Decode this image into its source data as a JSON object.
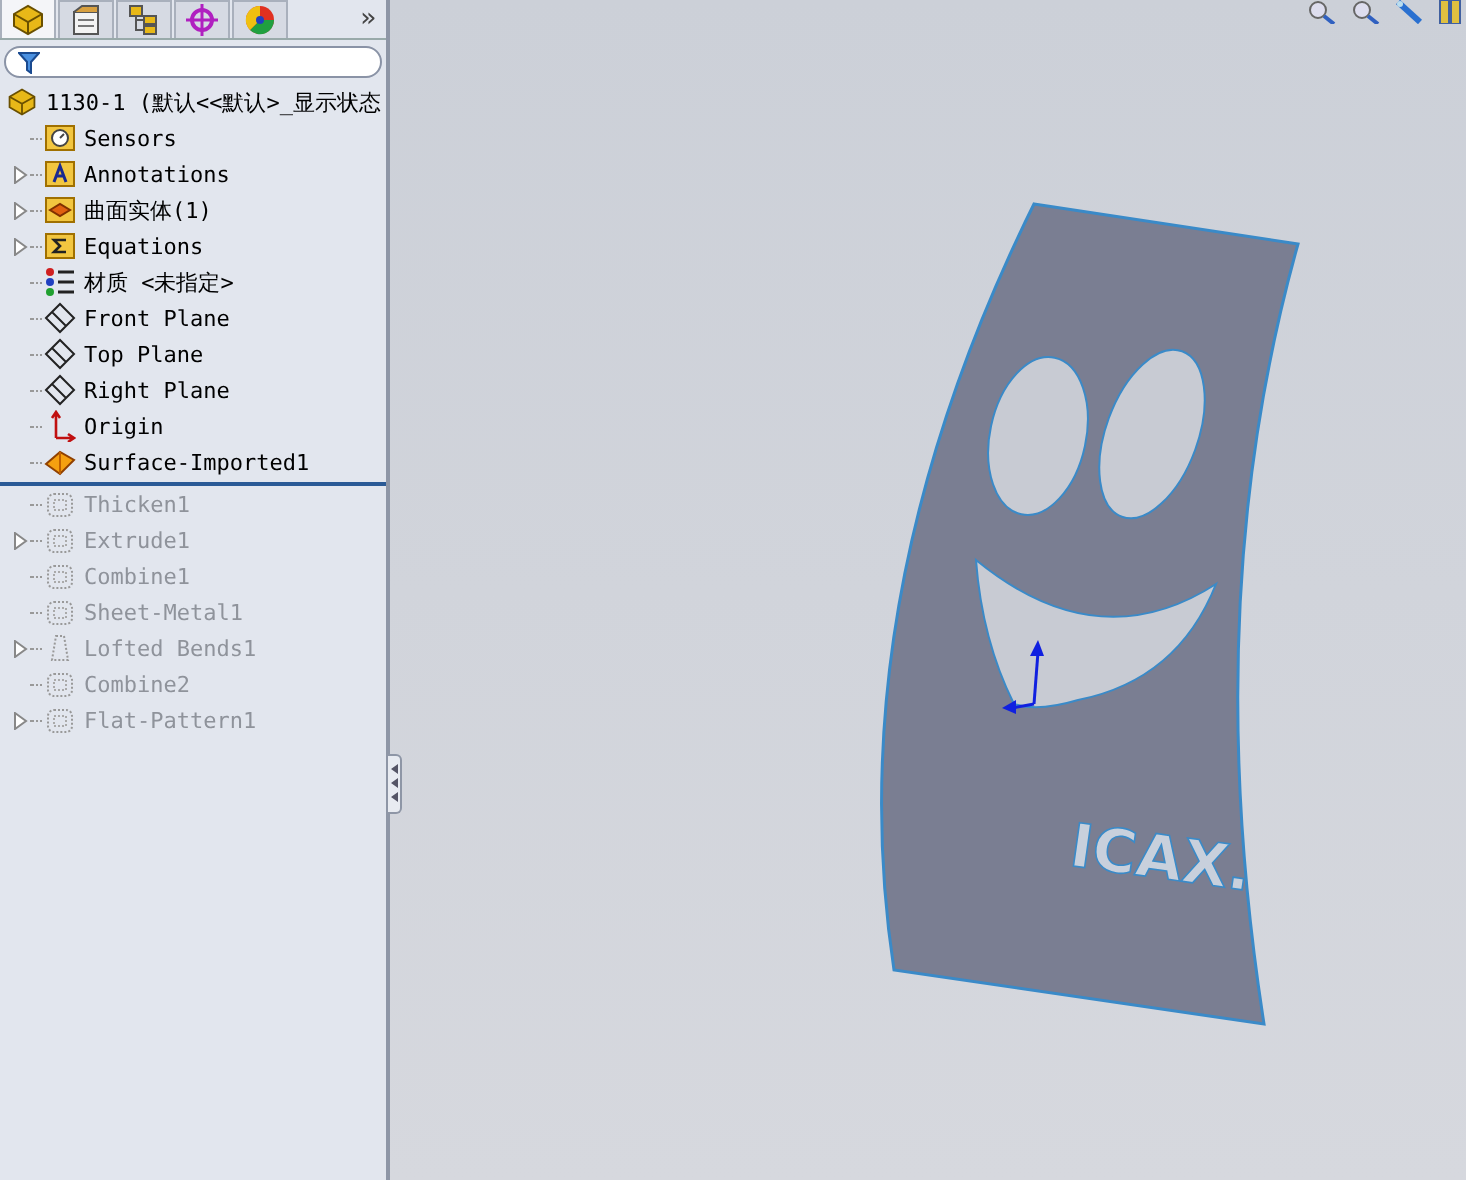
{
  "panel_tabs": [
    {
      "kind": "part",
      "selected": true
    },
    {
      "kind": "property",
      "selected": false
    },
    {
      "kind": "config",
      "selected": false
    },
    {
      "kind": "dimxpert",
      "selected": false
    },
    {
      "kind": "display",
      "selected": false
    }
  ],
  "more_tabs": "»",
  "tree": {
    "root": "1130-1   (默认<<默认>_显示状态",
    "items": [
      {
        "label": "Sensors",
        "kind": "sensors",
        "expandable": false,
        "rolled_back": false
      },
      {
        "label": "Annotations",
        "kind": "annotations",
        "expandable": true,
        "rolled_back": false
      },
      {
        "label": "曲面实体(1)",
        "kind": "bodies",
        "expandable": true,
        "rolled_back": false
      },
      {
        "label": "Equations",
        "kind": "equations",
        "expandable": true,
        "rolled_back": false
      },
      {
        "label": "材质 <未指定>",
        "kind": "material",
        "expandable": false,
        "rolled_back": false
      },
      {
        "label": "Front Plane",
        "kind": "plane",
        "expandable": false,
        "rolled_back": false
      },
      {
        "label": "Top Plane",
        "kind": "plane",
        "expandable": false,
        "rolled_back": false
      },
      {
        "label": "Right Plane",
        "kind": "plane",
        "expandable": false,
        "rolled_back": false
      },
      {
        "label": "Origin",
        "kind": "origin",
        "expandable": false,
        "rolled_back": false
      },
      {
        "label": "Surface-Imported1",
        "kind": "surface",
        "expandable": false,
        "rolled_back": false
      },
      {
        "label": "Thicken1",
        "kind": "feature",
        "expandable": false,
        "rolled_back": true
      },
      {
        "label": "Extrude1",
        "kind": "feature",
        "expandable": true,
        "rolled_back": true
      },
      {
        "label": "Combine1",
        "kind": "feature",
        "expandable": false,
        "rolled_back": true
      },
      {
        "label": "Sheet-Metal1",
        "kind": "feature",
        "expandable": false,
        "rolled_back": true
      },
      {
        "label": "Lofted Bends1",
        "kind": "loft",
        "expandable": true,
        "rolled_back": true
      },
      {
        "label": "Combine2",
        "kind": "feature",
        "expandable": false,
        "rolled_back": true
      },
      {
        "label": "Flat-Pattern1",
        "kind": "feature",
        "expandable": true,
        "rolled_back": true
      }
    ]
  },
  "model": {
    "engraved_text": "ICAX."
  }
}
